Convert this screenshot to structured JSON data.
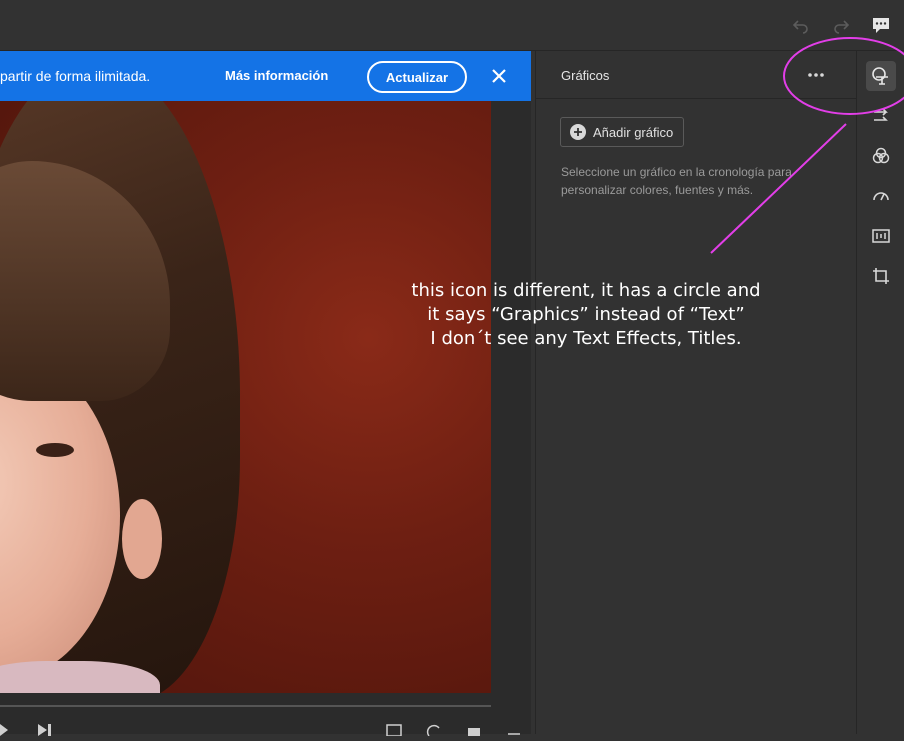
{
  "banner": {
    "message": "partir de forma ilimitada.",
    "more_link": "Más información",
    "update_button": "Actualizar"
  },
  "panel": {
    "title": "Gráficos",
    "add_button": "Añadir gráfico",
    "hint": "Seleccione un gráfico en la cronología para personalizar colores, fuentes y más."
  },
  "rail": {
    "icons": [
      "graphics-icon",
      "transitions-icon",
      "color-icon",
      "speed-icon",
      "audio-icon",
      "crop-icon"
    ],
    "active_icon": "graphics-icon"
  },
  "topbar": {
    "icons": [
      "undo-icon",
      "redo-icon",
      "chat-icon"
    ]
  },
  "annotation": {
    "line1": "this icon is different, it has a circle and",
    "line2": "it says “Graphics” instead of “Text”",
    "line3": "I don´t see any Text Effects, Titles.",
    "color": "#e23ee8"
  },
  "colors": {
    "banner": "#1473e6",
    "panel_bg": "#323232"
  }
}
